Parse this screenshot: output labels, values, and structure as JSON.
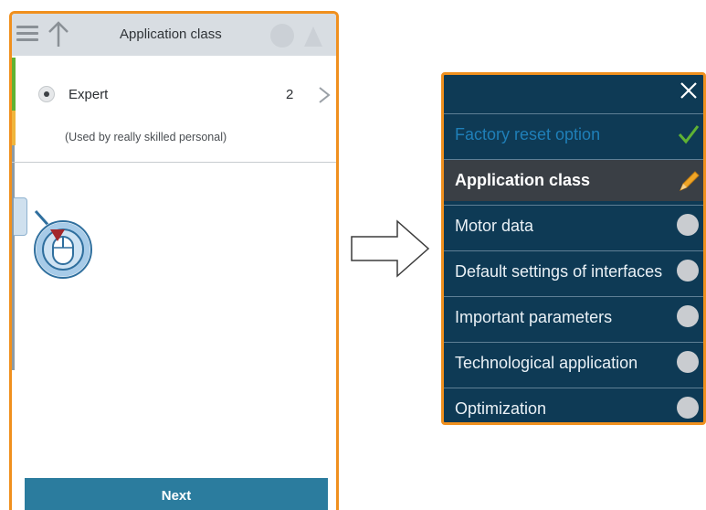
{
  "phone": {
    "title": "Application class",
    "option_label": "Expert",
    "option_count": "2",
    "option_description": "(Used by really skilled personal)",
    "next_label": "Next"
  },
  "menu": {
    "items": [
      {
        "label": "Factory reset option",
        "status": "check-icon"
      },
      {
        "label": "Application class",
        "status": "pencil-icon"
      },
      {
        "label": "Motor data",
        "status": "pending-dot"
      },
      {
        "label": "Default settings of interfaces",
        "status": "pending-dot"
      },
      {
        "label": "Important parameters",
        "status": "pending-dot"
      },
      {
        "label": "Technological application",
        "status": "pending-dot"
      },
      {
        "label": "Optimization",
        "status": "pending-dot"
      }
    ]
  },
  "colors": {
    "frame_highlight": "#f0901e",
    "menu_background": "#0e3a55",
    "active_row": "#3a3f45",
    "check_green": "#5fb233",
    "pencil_orange": "#f0a628",
    "next_button": "#2b7c9e"
  }
}
